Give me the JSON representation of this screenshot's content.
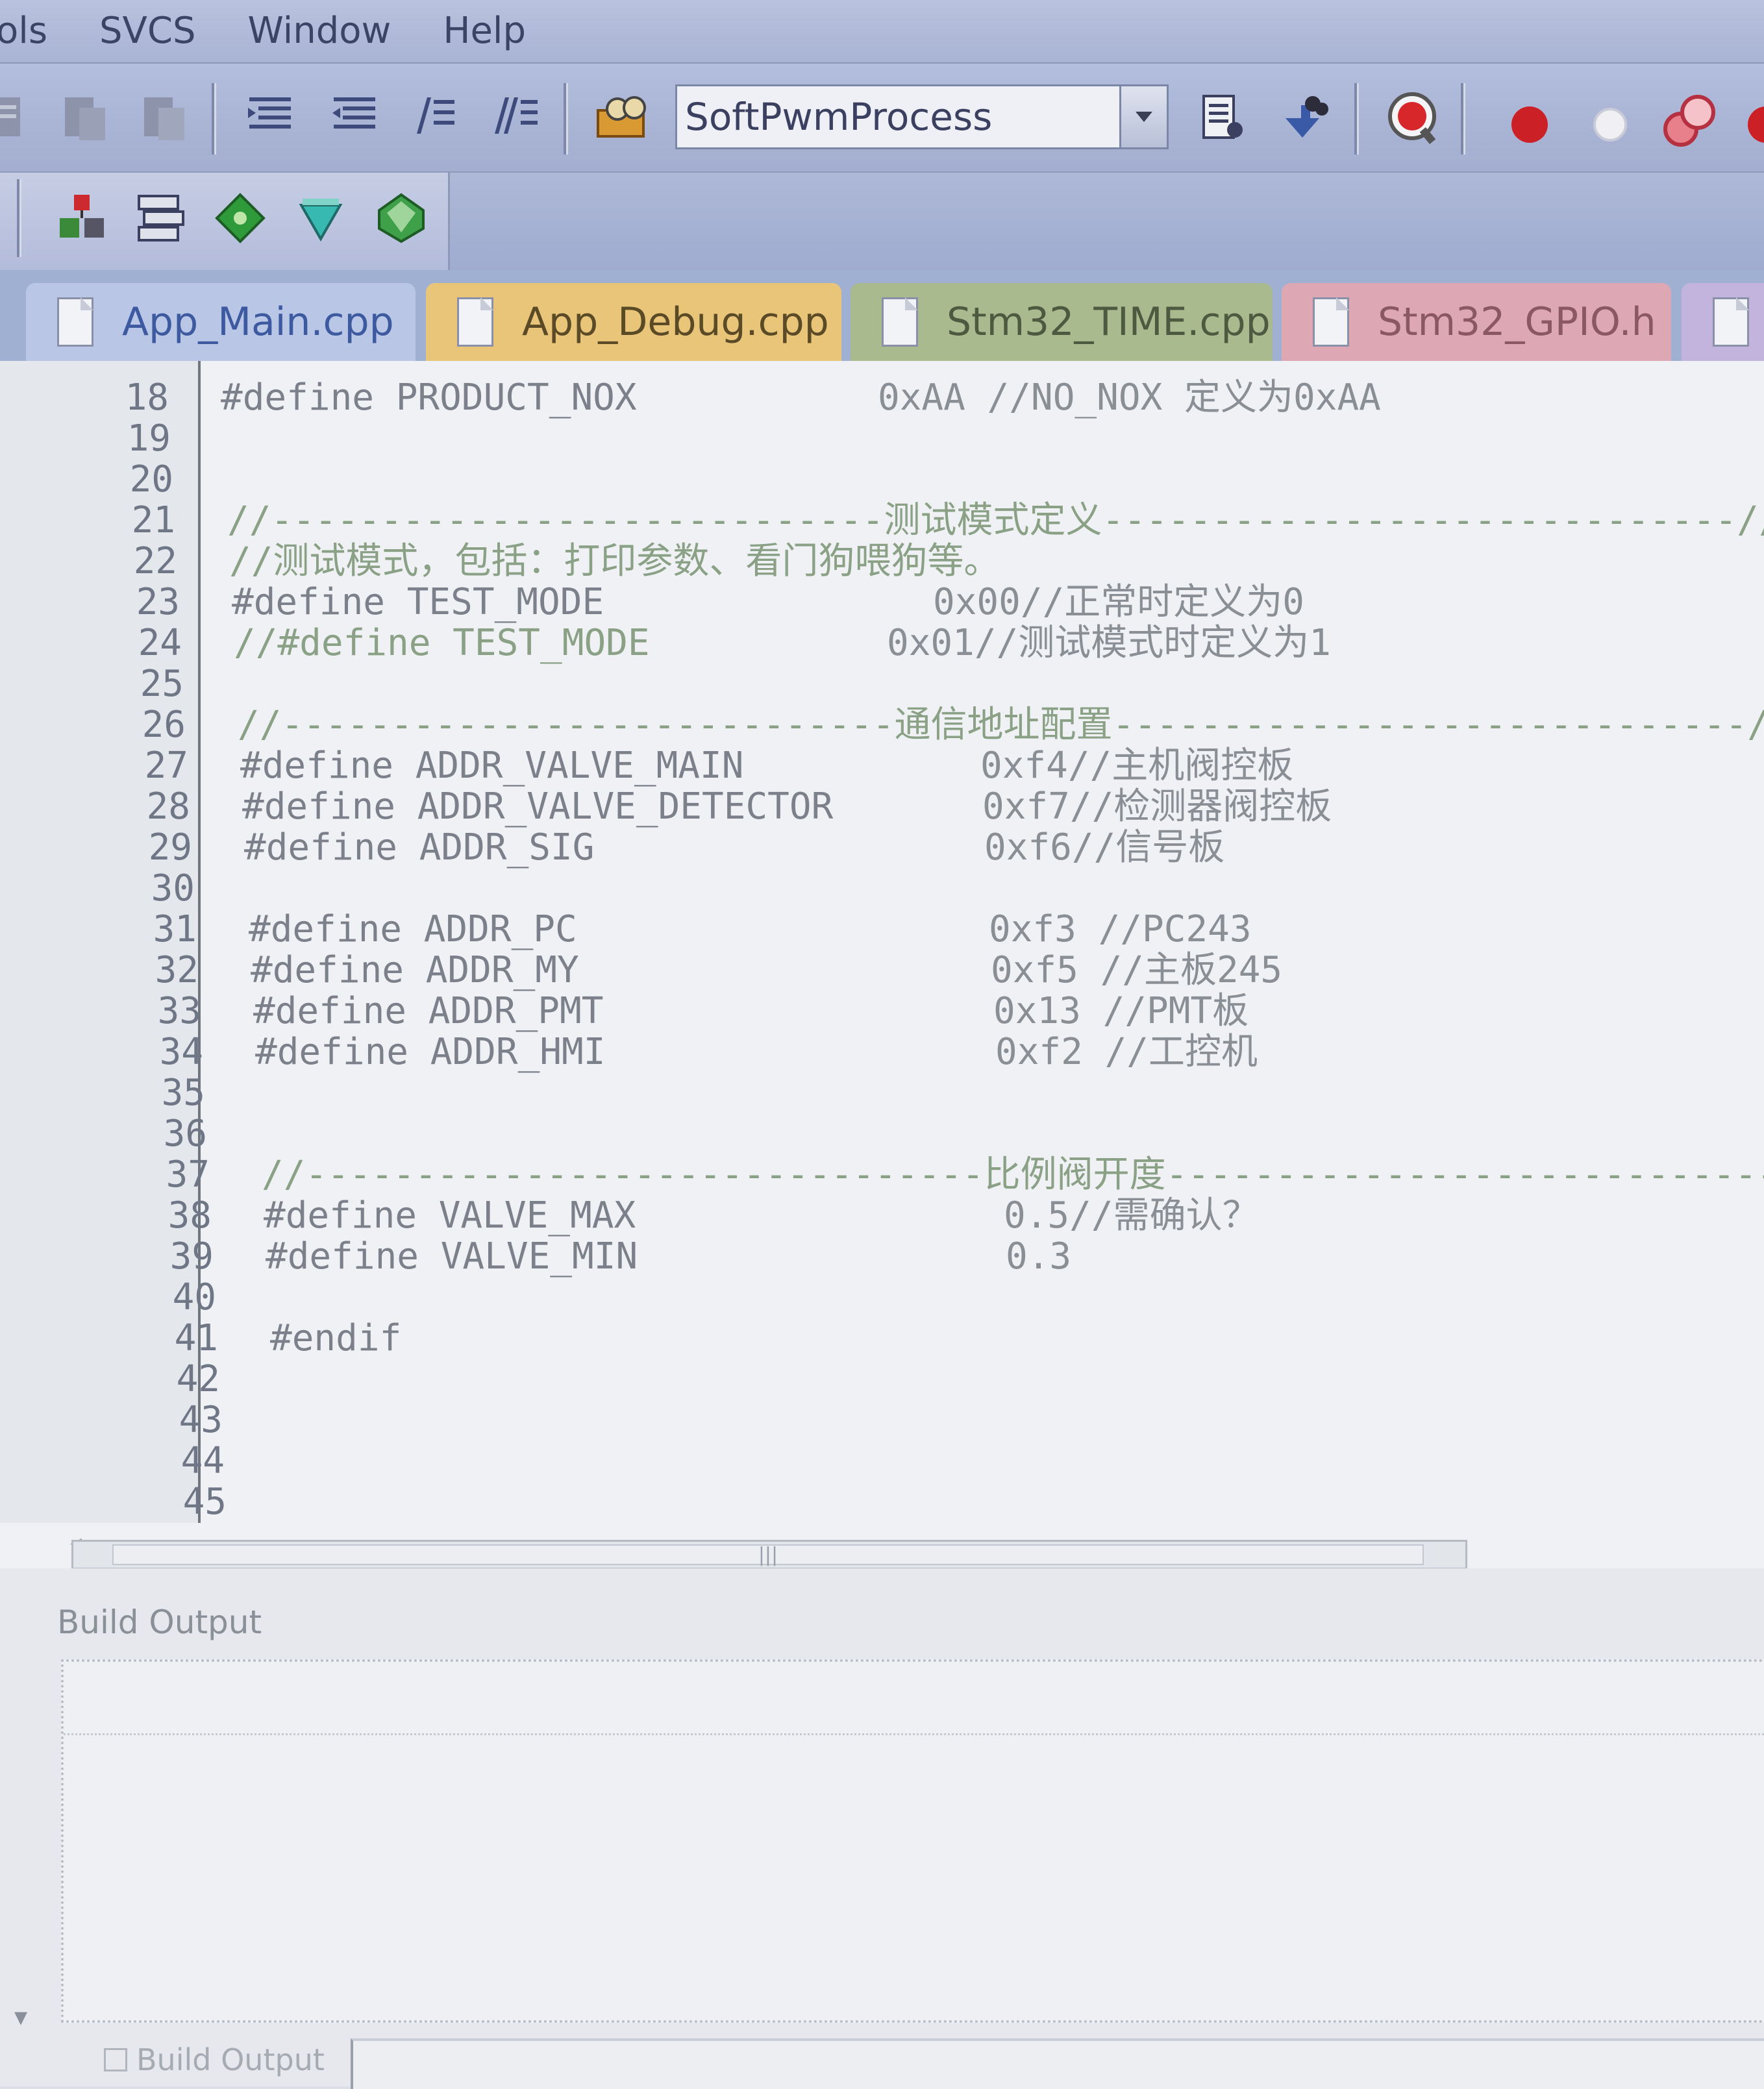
{
  "menu": [
    "ols",
    "SVCS",
    "Window",
    "Help"
  ],
  "toolbar": {
    "process_select": "SoftPwmProcess",
    "icons": [
      "bookmark-prev-icon",
      "bookmark-next-icon",
      "bookmark-clear-icon",
      "indent-icon",
      "outdent-icon",
      "comment-icon",
      "uncomment-icon",
      "find-process-icon",
      "find-icon",
      "find-replace-icon",
      "find-in-files-icon",
      "debug-stop-icon",
      "breakpoint-icon",
      "breakpoint-disable-icon",
      "breakpoint-clear-icon"
    ]
  },
  "toolbar2": {
    "icons": [
      "hierarchy-icon",
      "stack-icon",
      "green-diamond-icon",
      "cyan-diamond-icon",
      "green-gem-icon"
    ]
  },
  "tabs": [
    {
      "label": "App_Main.cpp",
      "color": "#b9c6e6",
      "text": "#3d5aa0"
    },
    {
      "label": "App_Debug.cpp",
      "color": "#e9c57a",
      "text": "#5a4a26"
    },
    {
      "label": "Stm32_TIME.cpp",
      "color": "#a9bb8e",
      "text": "#4d5a40"
    },
    {
      "label": "Stm32_GPIO.h",
      "color": "#dda7b4",
      "text": "#8a5862"
    }
  ],
  "code": [
    {
      "n": "18",
      "c": "#define PRODUCT_NOX",
      "v": "0xAA //NO_NOX 定义为0xAA"
    },
    {
      "n": "19",
      "c": "",
      "v": ""
    },
    {
      "n": "20",
      "c": "",
      "v": ""
    },
    {
      "n": "21",
      "c": "//----------------------------测试模式定义-----------------------------//",
      "v": ""
    },
    {
      "n": "22",
      "c": "//测试模式，包括：打印参数、看门狗喂狗等。",
      "v": ""
    },
    {
      "n": "23",
      "c": "#define TEST_MODE",
      "v": "0x00//正常时定义为0"
    },
    {
      "n": "24",
      "c": "//#define TEST_MODE",
      "v": "0x01//测试模式时定义为1"
    },
    {
      "n": "25",
      "c": "",
      "v": ""
    },
    {
      "n": "26",
      "c": "//----------------------------通信地址配置-----------------------------//",
      "v": ""
    },
    {
      "n": "27",
      "c": "#define ADDR_VALVE_MAIN",
      "v": "0xf4//主机阀控板"
    },
    {
      "n": "28",
      "c": "#define ADDR_VALVE_DETECTOR",
      "v": "0xf7//检测器阀控板"
    },
    {
      "n": "29",
      "c": "#define ADDR_SIG",
      "v": "0xf6//信号板"
    },
    {
      "n": "30",
      "c": "",
      "v": ""
    },
    {
      "n": "31",
      "c": "#define ADDR_PC",
      "v": "0xf3 //PC243"
    },
    {
      "n": "32",
      "c": "#define ADDR_MY",
      "v": "0xf5 //主板245"
    },
    {
      "n": "33",
      "c": "#define ADDR_PMT",
      "v": "0x13 //PMT板"
    },
    {
      "n": "34",
      "c": "#define ADDR_HMI",
      "v": "0xf2 //工控机"
    },
    {
      "n": "35",
      "c": "",
      "v": ""
    },
    {
      "n": "36",
      "c": "",
      "v": ""
    },
    {
      "n": "37",
      "c": "//-------------------------------比例阀开度----------------------------//",
      "v": ""
    },
    {
      "n": "38",
      "c": "#define VALVE_MAX",
      "v": "0.5//需确认？"
    },
    {
      "n": "39",
      "c": "#define VALVE_MIN",
      "v": "0.3"
    },
    {
      "n": "40",
      "c": "",
      "v": ""
    },
    {
      "n": "41",
      "c": "#endif",
      "v": ""
    },
    {
      "n": "42",
      "c": "",
      "v": ""
    },
    {
      "n": "43",
      "c": "",
      "v": ""
    },
    {
      "n": "44",
      "c": "",
      "v": ""
    },
    {
      "n": "45",
      "c": "",
      "v": ""
    }
  ],
  "scrollbar": {
    "thumb_label": "|||"
  },
  "build_output": {
    "title": "Build Output",
    "tab_label": "Build Output"
  }
}
